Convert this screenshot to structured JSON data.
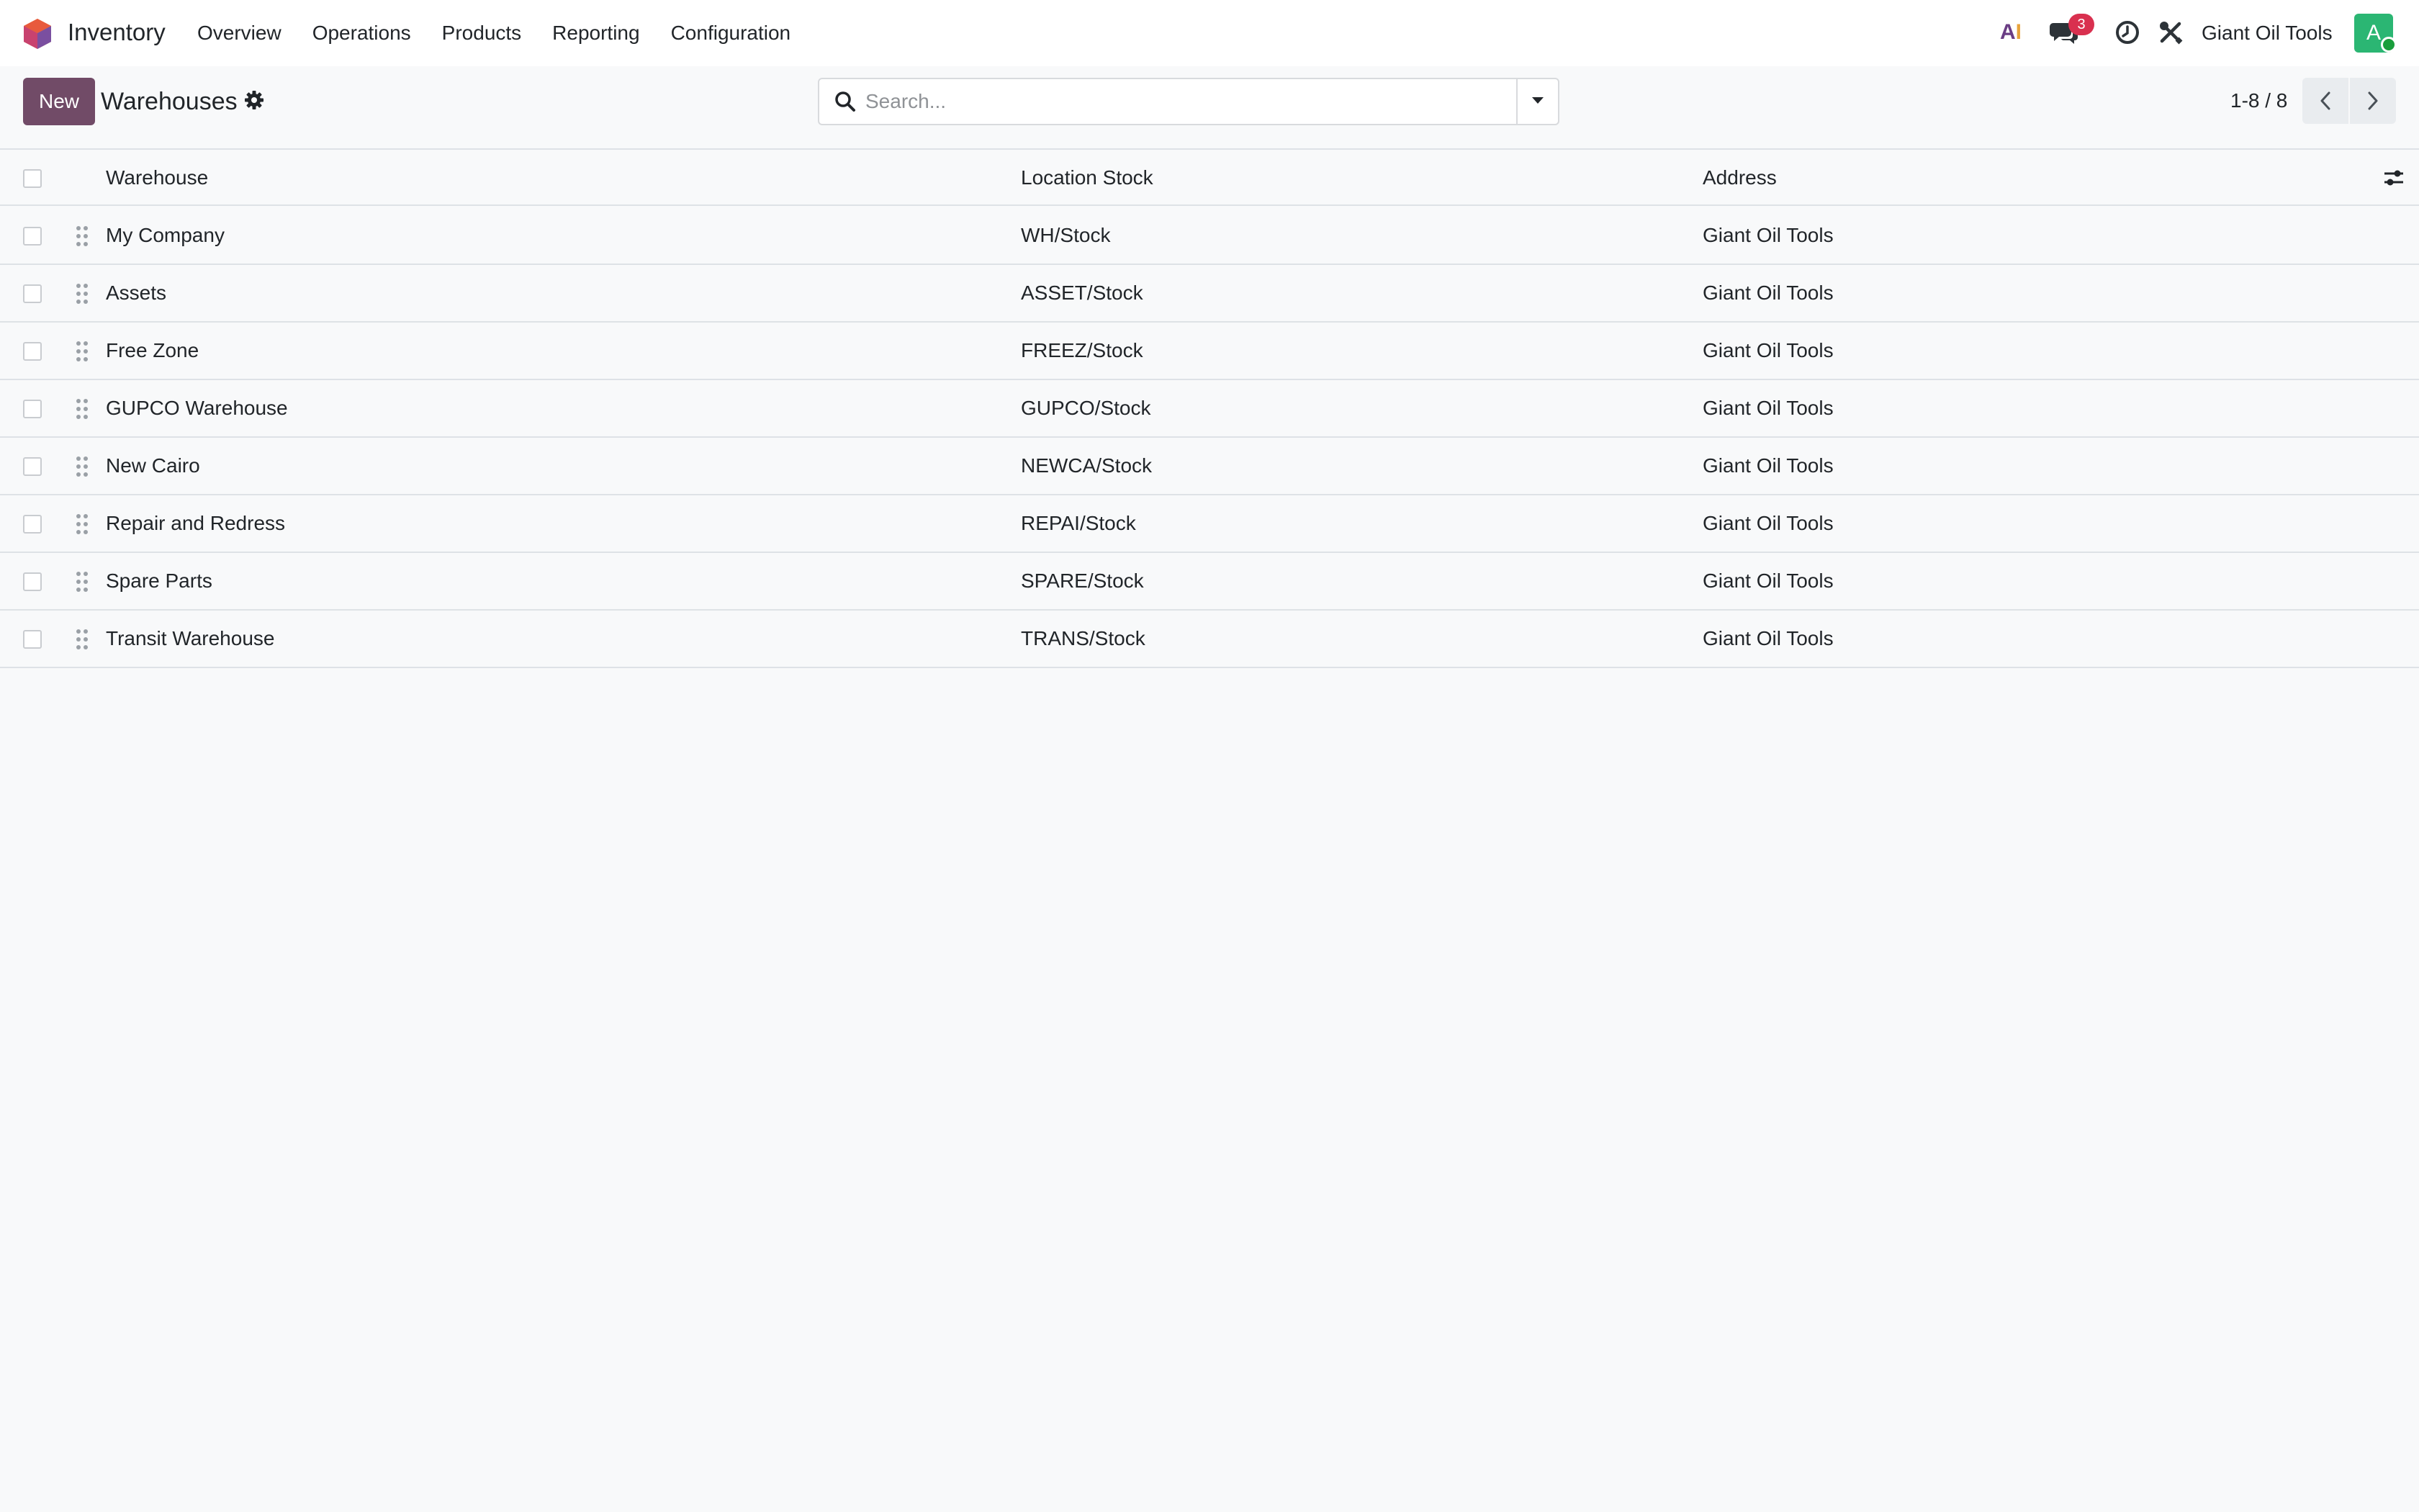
{
  "navbar": {
    "app_name": "Inventory",
    "menu": [
      "Overview",
      "Operations",
      "Products",
      "Reporting",
      "Configuration"
    ],
    "ai_label_a": "A",
    "ai_label_i": "I",
    "chat_count": "3",
    "company": "Giant Oil Tools",
    "avatar_letter": "A",
    "accent_color": "#714b67"
  },
  "control_panel": {
    "new_label": "New",
    "title": "Warehouses",
    "search_placeholder": "Search...",
    "pager": "1-8 / 8"
  },
  "table": {
    "columns": [
      "Warehouse",
      "Location Stock",
      "Address"
    ],
    "rows": [
      {
        "warehouse": "My Company",
        "location": "WH/Stock",
        "address": "Giant Oil Tools"
      },
      {
        "warehouse": "Assets",
        "location": "ASSET/Stock",
        "address": "Giant Oil Tools"
      },
      {
        "warehouse": "Free Zone",
        "location": "FREEZ/Stock",
        "address": "Giant Oil Tools"
      },
      {
        "warehouse": "GUPCO Warehouse",
        "location": "GUPCO/Stock",
        "address": "Giant Oil Tools"
      },
      {
        "warehouse": "New Cairo",
        "location": "NEWCA/Stock",
        "address": "Giant Oil Tools"
      },
      {
        "warehouse": "Repair and Redress",
        "location": "REPAI/Stock",
        "address": "Giant Oil Tools"
      },
      {
        "warehouse": "Spare Parts",
        "location": "SPARE/Stock",
        "address": "Giant Oil Tools"
      },
      {
        "warehouse": "Transit Warehouse",
        "location": "TRANS/Stock",
        "address": "Giant Oil Tools"
      }
    ]
  }
}
